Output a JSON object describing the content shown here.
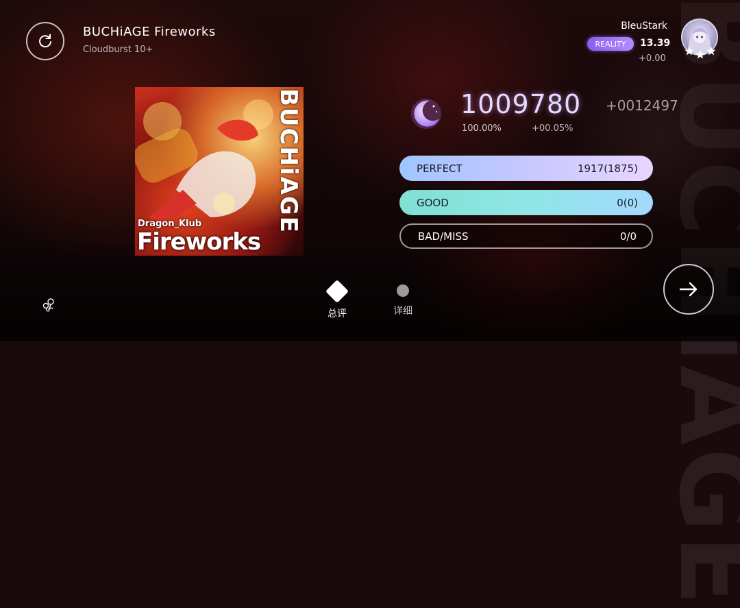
{
  "song": {
    "title": "BUCHiAGE Fireworks",
    "difficulty": "Cloudburst 10+"
  },
  "player": {
    "name": "BleuStark",
    "badge": "REALITY",
    "rks": "13.39",
    "rks_delta": "+0.00",
    "avatar_icon": "avatar-portrait",
    "star_icon": "star-icon"
  },
  "cover": {
    "vertical_text": "BUCHiAGE",
    "artist": "Dragon_Klub",
    "title": "Fireworks"
  },
  "result": {
    "rank_icon": "crescent-moon-icon",
    "score": "1009780",
    "score_delta": "+0012497",
    "accuracy": "100.00%",
    "accuracy_delta": "+00.05%"
  },
  "judgements": [
    {
      "label": "PERFECT",
      "value": "1917(1875)"
    },
    {
      "label": "GOOD",
      "value": "0(0)"
    },
    {
      "label": "BAD/MISS",
      "value": "0/0"
    }
  ],
  "tabs": [
    {
      "label": "总评",
      "icon": "diamond-icon",
      "active": true
    },
    {
      "label": "详细",
      "icon": "dot-icon",
      "active": false
    }
  ],
  "colors": {
    "perfect_gradient": [
      "#9fc6ff",
      "#e7d6ff"
    ],
    "good_gradient": [
      "#7fe0d3",
      "#a5d8ff"
    ],
    "badge": "#9b6ff5",
    "score": "#e7d8ff"
  },
  "background_text": "BUCHiAGE"
}
